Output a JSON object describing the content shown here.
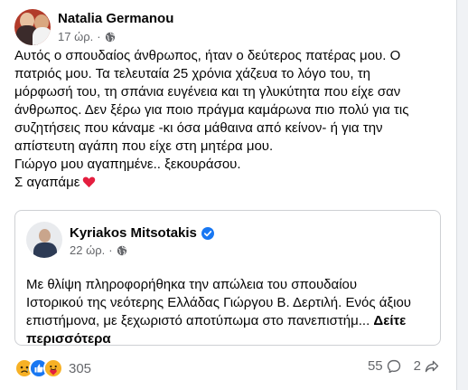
{
  "post": {
    "author": "Natalia Germanou",
    "time": "17 ώρ.",
    "separator": "·",
    "body_lines": [
      "Αυτός ο σπουδαίος άνθρωπος, ήταν ο δεύτερος πατέρας μου. Ο",
      "πατριός μου. Τα τελευταία 25 χρόνια χάζευα το λόγο του, τη",
      "μόρφωσή του, τη σπάνια ευγένεια και τη γλυκύτητα που είχε σαν",
      "άνθρωπος. Δεν ξέρω για ποιο πράγμα καμάρωνα πιο πολύ για τις",
      "συζητήσεις που κάναμε -κι όσα μάθαινα από κείνον- ή για την",
      "απίστευτη αγάπη που είχε στη μητέρα μου.",
      "Γιώργο μου αγαπημένε.. ξεκουράσου.",
      "Σ αγαπάμε"
    ]
  },
  "shared_post": {
    "author": "Kyriakos Mitsotakis",
    "time": "22 ώρ.",
    "separator": "·",
    "text_lines": [
      "Με θλίψη πληροφορήθηκα την απώλεια του σπουδαίου",
      "Ιστορικού της νεότερης Ελλάδας Γιώργου Β. Δερτιλή. Ενός άξιου",
      "επιστήμονα, με ξεχωριστό αποτύπωμα στο πανεπιστήμ... "
    ],
    "see_more_part1": "Δείτε",
    "see_more_part2": "περισσότερα"
  },
  "footer": {
    "reaction_count": "305",
    "comment_count": "55",
    "share_count": "2"
  },
  "icons": [
    "globe-icon",
    "heart-icon",
    "verified-icon",
    "sad-reaction-icon",
    "like-reaction-icon",
    "care-reaction-icon",
    "comment-icon",
    "share-icon"
  ],
  "colors": {
    "verified": "#1877f2",
    "heart": "#e41e3f",
    "meta_text": "#65676b"
  }
}
